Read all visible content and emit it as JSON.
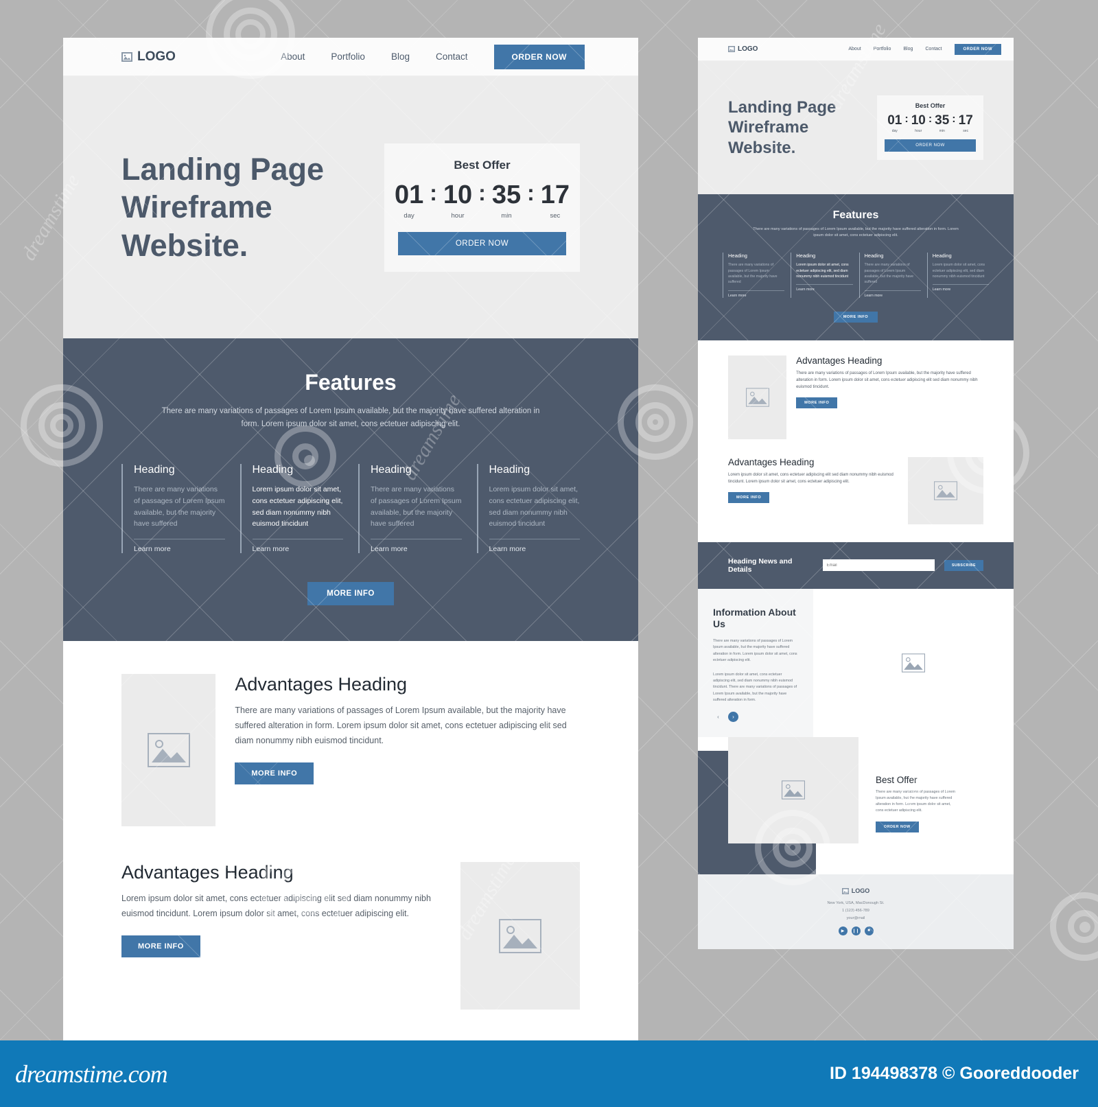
{
  "nav": {
    "logo": "LOGO",
    "logo_icon": "image-icon",
    "links": [
      "About",
      "Portfolio",
      "Blog",
      "Contact"
    ],
    "cta": "ORDER NOW"
  },
  "hero": {
    "title": "Landing Page Wireframe Website.",
    "offer": {
      "title": "Best Offer",
      "units": [
        {
          "value": "01",
          "label": "day"
        },
        {
          "value": "10",
          "label": "hour"
        },
        {
          "value": "35",
          "label": "min"
        },
        {
          "value": "17",
          "label": "sec"
        }
      ],
      "separator": ":",
      "cta": "ORDER NOW"
    }
  },
  "features": {
    "title": "Features",
    "subtitle": "There are many variations of passages of Lorem Ipsum available, but the majority have suffered alteration in form. Lorem ipsum dolor sit amet, cons ectetuer adipiscing elit.",
    "columns": [
      {
        "heading": "Heading",
        "body": "There are many variations of passages of Lorem Ipsum available, but the majority have suffered",
        "link": "Learn more",
        "emphasis": "dim"
      },
      {
        "heading": "Heading",
        "body": "Lorem ipsum dolor sit amet, cons ectetuer adipiscing elit, sed diam nonummy nibh euismod tincidunt",
        "link": "Learn more",
        "emphasis": "bright"
      },
      {
        "heading": "Heading",
        "body": "There are many variations of passages of Lorem Ipsum available, but the majority have suffered",
        "link": "Learn more",
        "emphasis": "dim"
      },
      {
        "heading": "Heading",
        "body": "Lorem ipsum dolor sit amet, cons ectetuer adipiscing elit, sed diam nonummy nibh euismod tincidunt",
        "link": "Learn more",
        "emphasis": "dim"
      }
    ],
    "more_info": "MORE INFO"
  },
  "advantages": {
    "block1": {
      "heading": "Advantages Heading",
      "body": "There are many variations of passages of Lorem Ipsum available, but the majority have suffered alteration in form. Lorem ipsum dolor sit amet, cons ectetuer adipiscing elit  sed diam nonummy nibh euismod tincidunt.",
      "button": "MORE INFO",
      "image_icon": "image-placeholder-icon"
    },
    "block2": {
      "heading": "Advantages Heading",
      "body": "Lorem ipsum dolor sit amet, cons ectetuer adipiscing elit  sed diam nonummy nibh euismod tincidunt. Lorem ipsum dolor sit amet, cons ectetuer adipiscing elit.",
      "button": "MORE INFO",
      "image_icon": "image-placeholder-icon"
    }
  },
  "newsletter": {
    "title": "Heading News and Details",
    "email_placeholder": "Email",
    "button": "SUBSCRIBE"
  },
  "info": {
    "title": "Information About Us",
    "paragraphs": [
      "There are many variations of passages of Lorem Ipsum available, but the majority have suffered alteration in form. Lorem ipsum dolor sit amet, cons ectetuer adipiscing elit.",
      "Lorem ipsum dolor sit amet, cons ectetuer adipiscing elit, sed diam nonummy nibh euismod tincidunt. There are many variations of passages of Lorem Ipsum available, but the majority have suffered alteration in form."
    ],
    "prev_icon": "chevron-left-icon",
    "next_icon": "chevron-right-icon",
    "image_icon": "image-placeholder-icon"
  },
  "best_offer": {
    "title": "Best Offer",
    "body": "There are many variations of passages of Lorem Ipsum available, but the majority have suffered alteration in form. Lorem ipsum dolor sit amet, cons ectetuer adipiscing elit.",
    "button": "ORDER NOW",
    "image_icon": "image-placeholder-icon"
  },
  "footer": {
    "logo": "LOGO",
    "address": "New York, USA, MacDonough St.",
    "phone": "1 (123) 456-789",
    "email": "your@mail",
    "social": [
      "play-icon",
      "pause-icon",
      "stop-icon"
    ]
  },
  "credit": {
    "brand": "dreamstime.com",
    "id": "ID 194498378 © Gooreddooder"
  },
  "colors": {
    "accent": "#4176a8",
    "dark": "#4e5a6c",
    "hero_bg": "#ececec",
    "placeholder": "#ebebeb",
    "credit_bar": "#1079b8"
  }
}
